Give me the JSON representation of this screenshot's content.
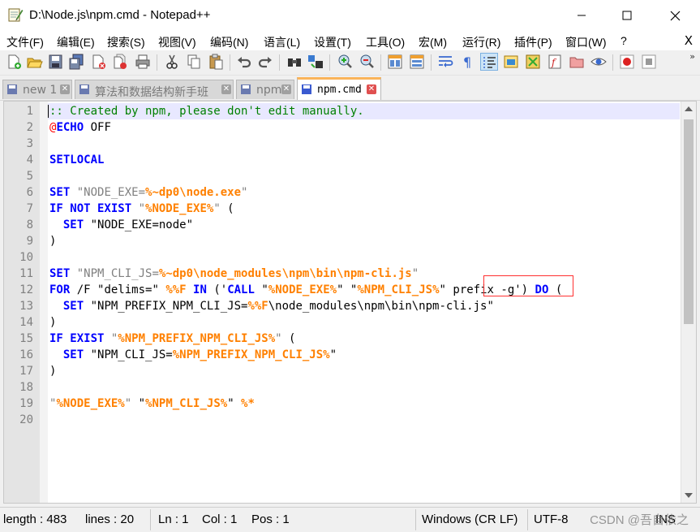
{
  "window": {
    "title": "D:\\Node.js\\npm.cmd - Notepad++"
  },
  "menu": {
    "items": [
      "文件(F)",
      "编辑(E)",
      "搜索(S)",
      "视图(V)",
      "编码(N)",
      "语言(L)",
      "设置(T)",
      "工具(O)",
      "宏(M)",
      "运行(R)",
      "插件(P)",
      "窗口(W)",
      "?"
    ],
    "close_glyph": "X"
  },
  "toolbar": {
    "overflow": "»"
  },
  "tabs": [
    {
      "label": "new 1",
      "active": false
    },
    {
      "label": "算法和数据结构新手班",
      "active": false
    },
    {
      "label": "npm",
      "active": false
    },
    {
      "label": "npm.cmd",
      "active": true
    }
  ],
  "editor": {
    "current_line": 1,
    "line_numbers": [
      "1",
      "2",
      "3",
      "4",
      "5",
      "6",
      "7",
      "8",
      "9",
      "10",
      "11",
      "12",
      "13",
      "14",
      "15",
      "16",
      "17",
      "18",
      "19",
      "20"
    ],
    "lines": [
      [
        [
          "cm",
          ":: Created by npm, please don't edit manually."
        ]
      ],
      [
        [
          "at",
          "@"
        ],
        [
          "kw",
          "ECHO"
        ],
        [
          "pl",
          " OFF"
        ]
      ],
      [],
      [
        [
          "kw",
          "SETLOCAL"
        ]
      ],
      [],
      [
        [
          "kw",
          "SET"
        ],
        [
          "str",
          " \"NODE_EXE="
        ],
        [
          "var",
          "%~dp0\\node.exe"
        ],
        [
          "str",
          "\""
        ]
      ],
      [
        [
          "kw",
          "IF NOT EXIST"
        ],
        [
          "str",
          " \""
        ],
        [
          "var",
          "%NODE_EXE%"
        ],
        [
          "str",
          "\""
        ],
        [
          "pl",
          " ("
        ]
      ],
      [
        [
          "pl",
          "  "
        ],
        [
          "kw",
          "SET"
        ],
        [
          "pl",
          " \"NODE_EXE=node\""
        ]
      ],
      [
        [
          "pl",
          ")"
        ]
      ],
      [],
      [
        [
          "kw",
          "SET"
        ],
        [
          "str",
          " \"NPM_CLI_JS="
        ],
        [
          "var",
          "%~dp0\\node_modules\\npm\\bin\\npm-cli.js"
        ],
        [
          "str",
          "\""
        ]
      ],
      [
        [
          "kw",
          "FOR"
        ],
        [
          "pl",
          " /F \"delims=\" "
        ],
        [
          "var",
          "%%F"
        ],
        [
          "pl",
          " "
        ],
        [
          "kw",
          "IN"
        ],
        [
          "pl",
          " ('"
        ],
        [
          "kw",
          "CALL"
        ],
        [
          "pl",
          " \""
        ],
        [
          "var",
          "%NODE_EXE%"
        ],
        [
          "pl",
          "\" \""
        ],
        [
          "var",
          "%NPM_CLI_JS%"
        ],
        [
          "pl",
          "\" prefix -g') "
        ],
        [
          "kw",
          "DO"
        ],
        [
          "pl",
          " ("
        ]
      ],
      [
        [
          "pl",
          "  "
        ],
        [
          "kw",
          "SET"
        ],
        [
          "pl",
          " \"NPM_PREFIX_NPM_CLI_JS="
        ],
        [
          "var",
          "%%F"
        ],
        [
          "pl",
          "\\node_modules\\npm\\bin\\npm-cli.js\""
        ]
      ],
      [
        [
          "pl",
          ")"
        ]
      ],
      [
        [
          "kw",
          "IF EXIST"
        ],
        [
          "str",
          " \""
        ],
        [
          "var",
          "%NPM_PREFIX_NPM_CLI_JS%"
        ],
        [
          "str",
          "\""
        ],
        [
          "pl",
          " ("
        ]
      ],
      [
        [
          "pl",
          "  "
        ],
        [
          "kw",
          "SET"
        ],
        [
          "pl",
          " \"NPM_CLI_JS="
        ],
        [
          "var",
          "%NPM_PREFIX_NPM_CLI_JS%"
        ],
        [
          "pl",
          "\""
        ]
      ],
      [
        [
          "pl",
          ")"
        ]
      ],
      [],
      [
        [
          "str",
          "\""
        ],
        [
          "var",
          "%NODE_EXE%"
        ],
        [
          "str",
          "\""
        ],
        [
          "pl",
          " \""
        ],
        [
          "var",
          "%NPM_CLI_JS%"
        ],
        [
          "pl",
          "\" "
        ],
        [
          "var",
          "%*"
        ]
      ],
      []
    ]
  },
  "status": {
    "length": "length : 483",
    "lines": "lines : 20",
    "ln": "Ln : 1",
    "col": "Col : 1",
    "pos": "Pos : 1",
    "eol": "Windows (CR LF)",
    "encoding": "UTF-8",
    "ins": "INS",
    "watermark": "CSDN @吾自依之"
  },
  "colors": {
    "keyword": "#0000ff",
    "variable": "#ff8000",
    "comment": "#008000",
    "string": "#808080",
    "current_line": "#e8e8ff",
    "tab_accent": "#fab45a"
  }
}
